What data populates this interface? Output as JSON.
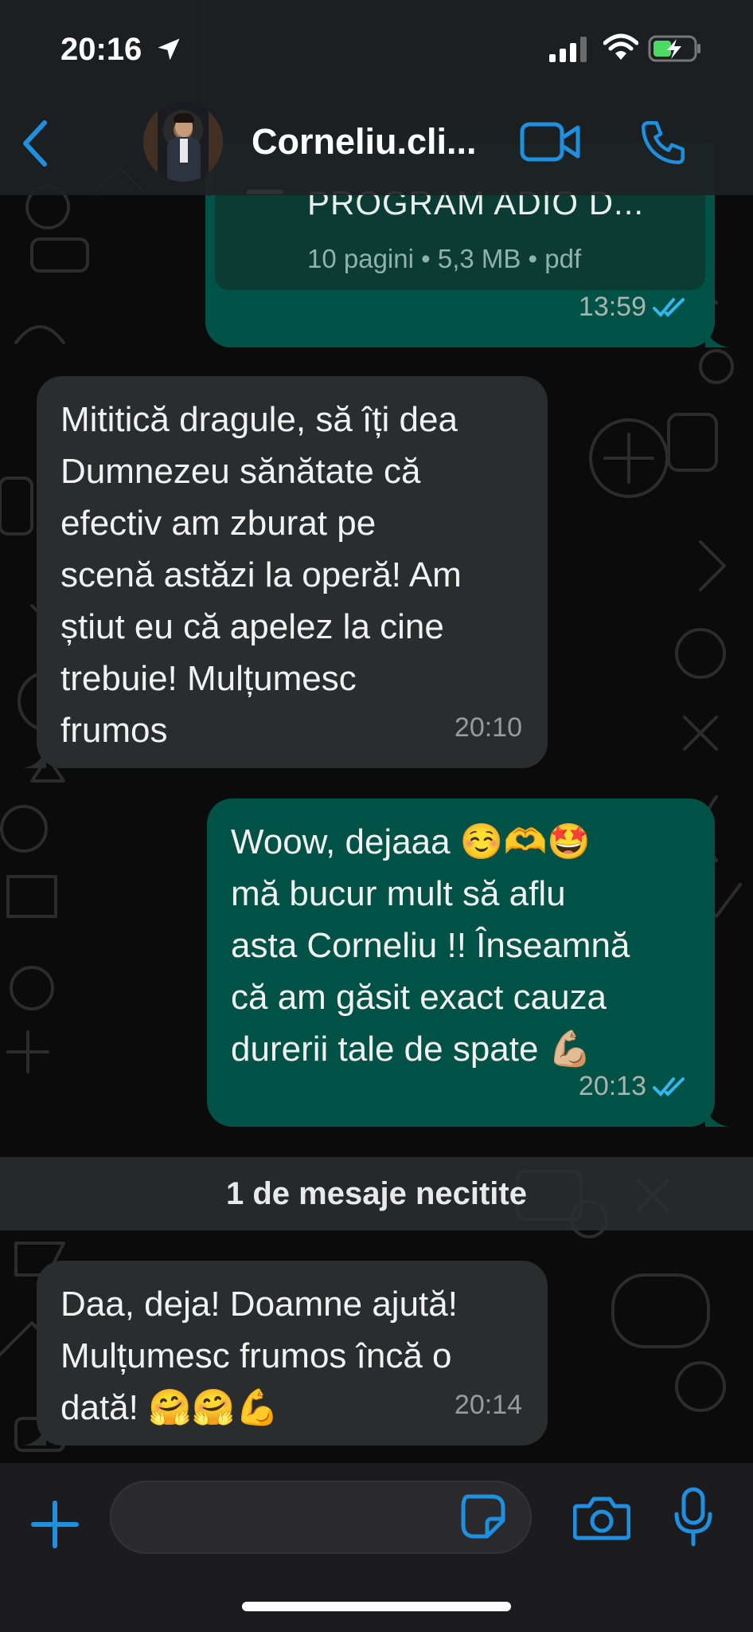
{
  "status_bar": {
    "time": "20:16"
  },
  "header": {
    "contact_name": "Corneliu.cli..."
  },
  "document_message": {
    "file_name": "PROGRAM ADIO D...",
    "file_info": "10 pagini • 5,3 MB • pdf",
    "time": "13:59",
    "status": "read"
  },
  "messages": [
    {
      "direction": "incoming",
      "text": "Mititică dragule, să îți dea\nDumnezeu sănătate că\nefectiv am zburat pe\nscenă astăzi la operă! Am\nștiut eu că apelez la cine\ntrebuie! Mulțumesc\nfrumos",
      "time": "20:10"
    },
    {
      "direction": "outgoing",
      "text": "Woow, dejaaa ☺️🫶🤩\nmă bucur mult să aflu\nasta Corneliu !! Înseamnă\ncă am găsit exact cauza\ndurerii tale de spate 💪🏼",
      "time": "20:13",
      "status": "read"
    },
    {
      "direction": "incoming",
      "text": "Daa, deja! Doamne ajută!\nMulțumesc frumos încă o\ndată! 🤗🤗💪",
      "time": "20:14"
    }
  ],
  "unread_divider": "1 de mesaje necitite",
  "composer": {
    "placeholder": ""
  },
  "colors": {
    "accent": "#1f8fe0",
    "outgoing_bubble": "#005246",
    "incoming_bubble": "#2a2d2e",
    "read_ticks": "#34b7f1"
  }
}
